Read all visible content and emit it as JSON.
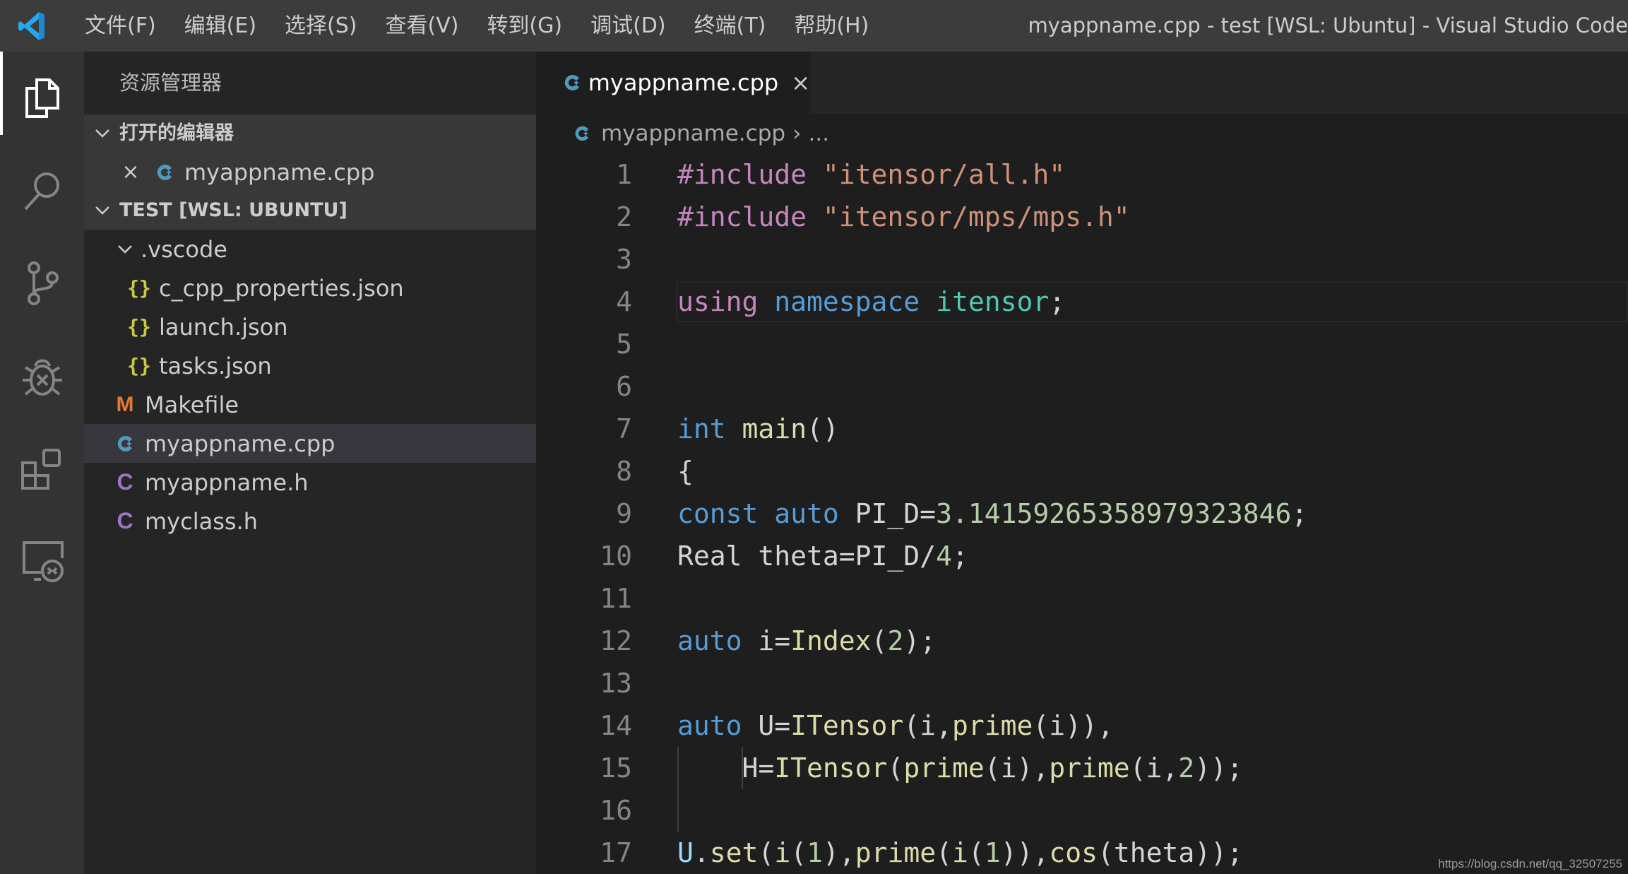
{
  "titlebar": {
    "menu": [
      "文件(F)",
      "编辑(E)",
      "选择(S)",
      "查看(V)",
      "转到(G)",
      "调试(D)",
      "终端(T)",
      "帮助(H)"
    ],
    "window_title": "myappname.cpp - test [WSL: Ubuntu] - Visual Studio Code"
  },
  "activitybar": {
    "items": [
      "explorer-icon",
      "search-icon",
      "source-control-icon",
      "debug-icon",
      "extensions-icon",
      "remote-explorer-icon"
    ],
    "active": "explorer-icon"
  },
  "sidebar": {
    "title": "资源管理器",
    "open_editors_label": "打开的编辑器",
    "open_editors": [
      {
        "name": "myappname.cpp",
        "icon": "cpp"
      }
    ],
    "workspace_label": "TEST [WSL: UBUNTU]",
    "tree": [
      {
        "name": ".vscode",
        "type": "folder",
        "expanded": true
      },
      {
        "name": "c_cpp_properties.json",
        "icon": "json",
        "glyph": "{}"
      },
      {
        "name": "launch.json",
        "icon": "json",
        "glyph": "{}"
      },
      {
        "name": "tasks.json",
        "icon": "json",
        "glyph": "{}"
      },
      {
        "name": "Makefile",
        "icon": "makefile",
        "glyph": "M"
      },
      {
        "name": "myappname.cpp",
        "icon": "cpp",
        "selected": true
      },
      {
        "name": "myappname.h",
        "icon": "header",
        "glyph": "C"
      },
      {
        "name": "myclass.h",
        "icon": "header",
        "glyph": "C"
      }
    ]
  },
  "editor": {
    "tab": {
      "label": "myappname.cpp",
      "close": "×"
    },
    "breadcrumb": {
      "file": "myappname.cpp",
      "separator": "›",
      "more": "..."
    },
    "current_line": 4,
    "lines": [
      {
        "n": "1",
        "tokens": [
          [
            "pre",
            "#include"
          ],
          [
            "plain",
            " "
          ],
          [
            "str",
            "\"itensor/all.h\""
          ]
        ]
      },
      {
        "n": "2",
        "tokens": [
          [
            "pre",
            "#include"
          ],
          [
            "plain",
            " "
          ],
          [
            "str",
            "\"itensor/mps/mps.h\""
          ]
        ]
      },
      {
        "n": "3",
        "tokens": []
      },
      {
        "n": "4",
        "tokens": [
          [
            "pre",
            "using"
          ],
          [
            "plain",
            " "
          ],
          [
            "kw",
            "namespace"
          ],
          [
            "plain",
            " "
          ],
          [
            "ns",
            "itensor"
          ],
          [
            "plain",
            ";"
          ]
        ]
      },
      {
        "n": "5",
        "tokens": []
      },
      {
        "n": "6",
        "tokens": []
      },
      {
        "n": "7",
        "tokens": [
          [
            "kw",
            "int"
          ],
          [
            "plain",
            " "
          ],
          [
            "fn",
            "main"
          ],
          [
            "plain",
            "()"
          ]
        ]
      },
      {
        "n": "8",
        "tokens": [
          [
            "plain",
            "{"
          ]
        ]
      },
      {
        "n": "9",
        "tokens": [
          [
            "kw",
            "const"
          ],
          [
            "plain",
            " "
          ],
          [
            "kw",
            "auto"
          ],
          [
            "plain",
            " PI_D="
          ],
          [
            "num",
            "3.14159265358979323846"
          ],
          [
            "plain",
            ";"
          ]
        ]
      },
      {
        "n": "10",
        "tokens": [
          [
            "plain",
            "Real theta=PI_D/"
          ],
          [
            "num",
            "4"
          ],
          [
            "plain",
            ";"
          ]
        ]
      },
      {
        "n": "11",
        "tokens": []
      },
      {
        "n": "12",
        "tokens": [
          [
            "kw",
            "auto"
          ],
          [
            "plain",
            " i="
          ],
          [
            "fn",
            "Index"
          ],
          [
            "plain",
            "("
          ],
          [
            "num",
            "2"
          ],
          [
            "plain",
            ");"
          ]
        ]
      },
      {
        "n": "13",
        "tokens": []
      },
      {
        "n": "14",
        "tokens": [
          [
            "kw",
            "auto"
          ],
          [
            "plain",
            " U="
          ],
          [
            "fn",
            "ITensor"
          ],
          [
            "plain",
            "(i,"
          ],
          [
            "fn",
            "prime"
          ],
          [
            "plain",
            "(i)),"
          ]
        ]
      },
      {
        "n": "15",
        "tokens": [
          [
            "plain",
            "    H="
          ],
          [
            "fn",
            "ITensor"
          ],
          [
            "plain",
            "("
          ],
          [
            "fn",
            "prime"
          ],
          [
            "plain",
            "(i),"
          ],
          [
            "fn",
            "prime"
          ],
          [
            "plain",
            "(i,"
          ],
          [
            "num",
            "2"
          ],
          [
            "plain",
            "));"
          ]
        ]
      },
      {
        "n": "16",
        "tokens": []
      },
      {
        "n": "17",
        "tokens": [
          [
            "var",
            "U"
          ],
          [
            "plain",
            "."
          ],
          [
            "fn",
            "set"
          ],
          [
            "plain",
            "("
          ],
          [
            "fn",
            "i"
          ],
          [
            "plain",
            "("
          ],
          [
            "num",
            "1"
          ],
          [
            "plain",
            "),"
          ],
          [
            "fn",
            "prime"
          ],
          [
            "plain",
            "("
          ],
          [
            "fn",
            "i"
          ],
          [
            "plain",
            "("
          ],
          [
            "num",
            "1"
          ],
          [
            "plain",
            ")),"
          ],
          [
            "fn",
            "cos"
          ],
          [
            "plain",
            "(theta));"
          ]
        ]
      }
    ]
  },
  "watermark": "https://blog.csdn.net/qq_32507255",
  "colors": {
    "cpp_icon": "#519aba",
    "json_icon": "#cbcb41",
    "makefile_icon": "#e37933",
    "header_icon": "#a074c4",
    "vscode_logo": "#23a9f2"
  }
}
